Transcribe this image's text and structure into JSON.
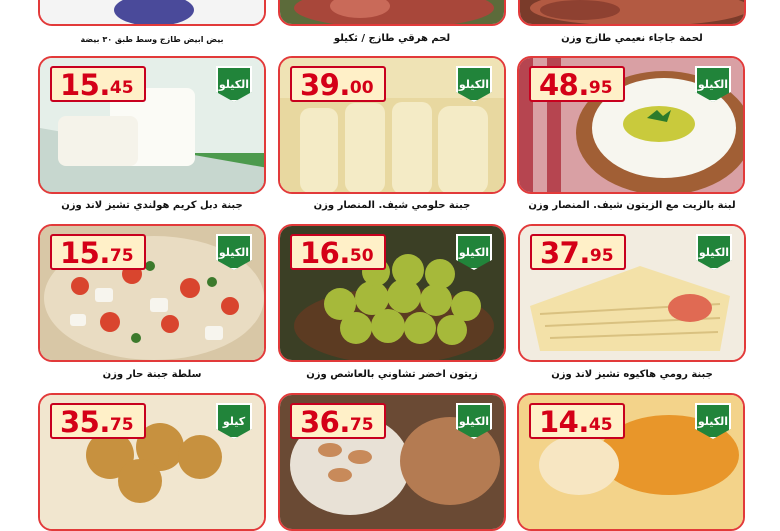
{
  "colors": {
    "card_border": "#e23a3a",
    "price_text": "#d40017",
    "price_bg": "#fff0c8",
    "badge_bg": "#21843a"
  },
  "row0": {
    "labels": [
      "لحمة جاجاء نعيمي طازج وزن",
      "لحم هرقي طازج / ثكيلو",
      "بيض ابيض طازج وسط طبق ٣٠ بيضة"
    ]
  },
  "products": [
    {
      "label": "لبنة بالزيت مع الزيتون شيف. المنصار وزن",
      "price_big": "48.",
      "price_small": "95",
      "badge": "الكيلو",
      "icon": "labneh-bowl-image"
    },
    {
      "label": "جبنة حلومي شيف. المنصار وزن",
      "price_big": "39.",
      "price_small": "00",
      "badge": "الكيلو",
      "icon": "halloumi-cheese-image"
    },
    {
      "label": "جبنة دبل كريم هولندي تشيز لاند وزن",
      "price_big": "15.",
      "price_small": "45",
      "badge": "الكيلو",
      "icon": "cream-cheese-image"
    },
    {
      "label": "جبنة رومي هاكيوه تشيز لاند وزن",
      "price_big": "37.",
      "price_small": "95",
      "badge": "الكيلو",
      "icon": "roumi-cheese-image"
    },
    {
      "label": "زيتون اخضر تشاوني بالعاشص وزن",
      "price_big": "16.",
      "price_small": "50",
      "badge": "الكيلو",
      "icon": "green-olives-image"
    },
    {
      "label": "سلطة جبنة حار وزن",
      "price_big": "15.",
      "price_small": "75",
      "badge": "الكيلو",
      "icon": "cheese-salad-image"
    },
    {
      "label": "",
      "price_big": "14.",
      "price_small": "45",
      "badge": "الكيلو",
      "icon": "apricot-jam-image"
    },
    {
      "label": "",
      "price_big": "36.",
      "price_small": "75",
      "badge": "الكيلو",
      "icon": "mixed-nuts-image"
    },
    {
      "label": "",
      "price_big": "35.",
      "price_small": "75",
      "badge": "كيلو",
      "icon": "falafel-image"
    }
  ]
}
